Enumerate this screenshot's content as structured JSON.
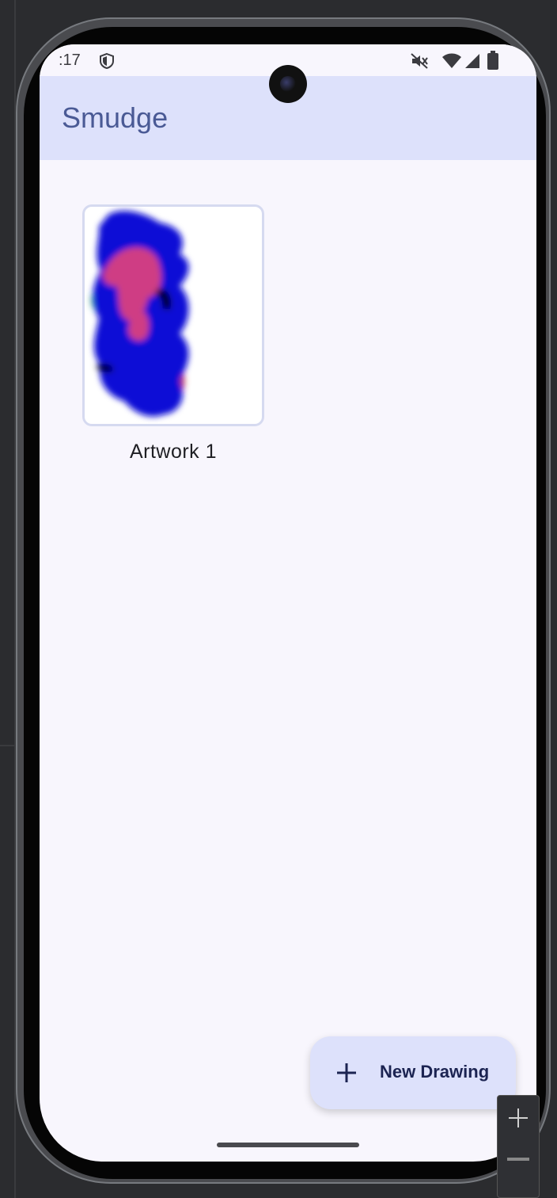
{
  "status_bar": {
    "time": ":17",
    "icons": [
      "shield-icon",
      "mute-icon",
      "wifi-icon",
      "signal-icon",
      "battery-icon"
    ]
  },
  "app_bar": {
    "title": "Smudge"
  },
  "gallery": {
    "items": [
      {
        "label": "Artwork 1"
      }
    ]
  },
  "fab": {
    "label": "New Drawing",
    "icon": "plus-icon"
  },
  "emulator_controls": {
    "icons": [
      "zoom-in-icon",
      "zoom-out-icon"
    ]
  },
  "colors": {
    "app_bar_bg": "#dde1fb",
    "title": "#4a5a95",
    "screen_bg": "#f8f6fd",
    "fab_bg": "#dde1fb",
    "fab_text": "#1c2452"
  }
}
